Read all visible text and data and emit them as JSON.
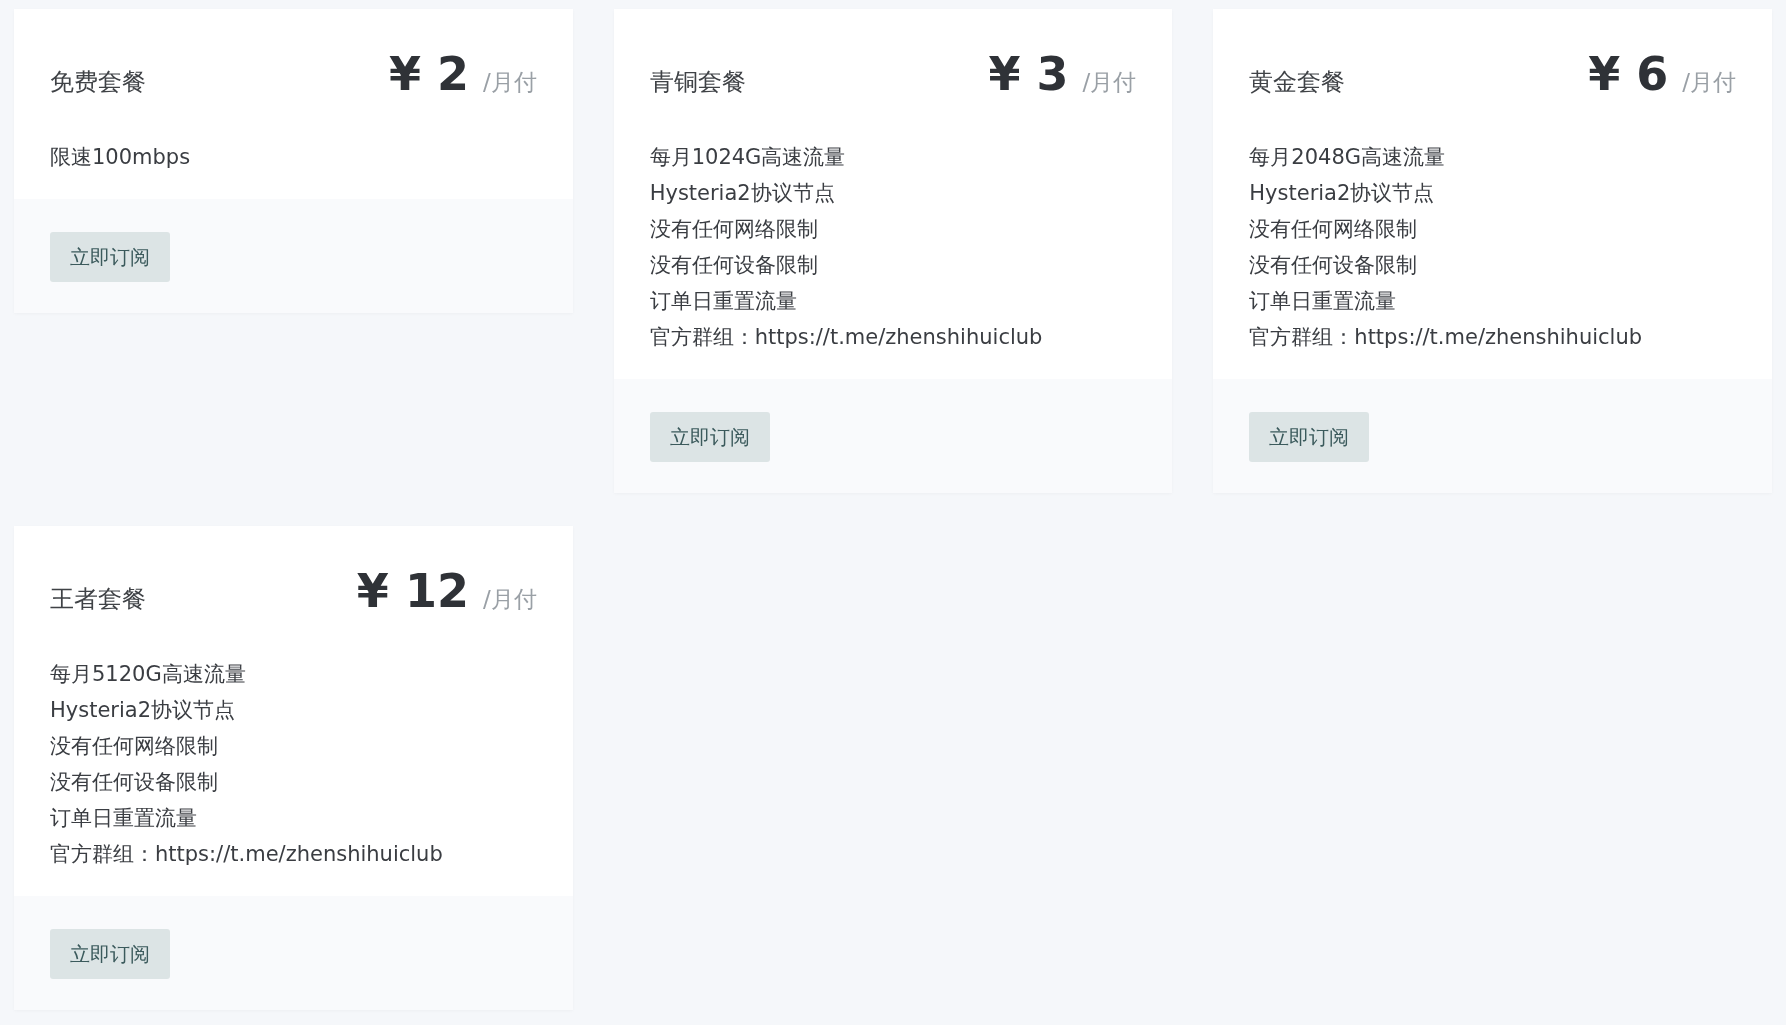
{
  "plans": [
    {
      "name": "免费套餐",
      "currency": "¥",
      "price": "2",
      "period": "/月付",
      "features": [
        "限速100mbps"
      ],
      "button": "立即订阅"
    },
    {
      "name": "青铜套餐",
      "currency": "¥",
      "price": "3",
      "period": "/月付",
      "features": [
        "每月1024G高速流量",
        "Hysteria2协议节点",
        "没有任何网络限制",
        "没有任何设备限制",
        "订单日重置流量",
        "官方群组：https://t.me/zhenshihuiclub"
      ],
      "button": "立即订阅"
    },
    {
      "name": "黄金套餐",
      "currency": "¥",
      "price": "6",
      "period": "/月付",
      "features": [
        "每月2048G高速流量",
        "Hysteria2协议节点",
        "没有任何网络限制",
        "没有任何设备限制",
        "订单日重置流量",
        "官方群组：https://t.me/zhenshihuiclub"
      ],
      "button": "立即订阅"
    },
    {
      "name": "王者套餐",
      "currency": "¥",
      "price": "12",
      "period": "/月付",
      "features": [
        "每月5120G高速流量",
        "Hysteria2协议节点",
        "没有任何网络限制",
        "没有任何设备限制",
        "订单日重置流量",
        "官方群组：https://t.me/zhenshihuiclub"
      ],
      "button": "立即订阅"
    }
  ]
}
